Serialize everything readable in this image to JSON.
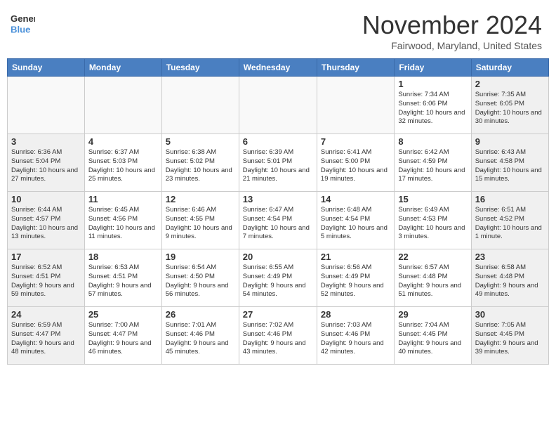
{
  "header": {
    "logo": {
      "general": "General",
      "blue": "Blue"
    },
    "title": "November 2024",
    "location": "Fairwood, Maryland, United States"
  },
  "calendar": {
    "days_of_week": [
      "Sunday",
      "Monday",
      "Tuesday",
      "Wednesday",
      "Thursday",
      "Friday",
      "Saturday"
    ],
    "weeks": [
      [
        {
          "day": "",
          "info": ""
        },
        {
          "day": "",
          "info": ""
        },
        {
          "day": "",
          "info": ""
        },
        {
          "day": "",
          "info": ""
        },
        {
          "day": "",
          "info": ""
        },
        {
          "day": "1",
          "info": "Sunrise: 7:34 AM\nSunset: 6:06 PM\nDaylight: 10 hours and 32 minutes."
        },
        {
          "day": "2",
          "info": "Sunrise: 7:35 AM\nSunset: 6:05 PM\nDaylight: 10 hours and 30 minutes."
        }
      ],
      [
        {
          "day": "3",
          "info": "Sunrise: 6:36 AM\nSunset: 5:04 PM\nDaylight: 10 hours and 27 minutes."
        },
        {
          "day": "4",
          "info": "Sunrise: 6:37 AM\nSunset: 5:03 PM\nDaylight: 10 hours and 25 minutes."
        },
        {
          "day": "5",
          "info": "Sunrise: 6:38 AM\nSunset: 5:02 PM\nDaylight: 10 hours and 23 minutes."
        },
        {
          "day": "6",
          "info": "Sunrise: 6:39 AM\nSunset: 5:01 PM\nDaylight: 10 hours and 21 minutes."
        },
        {
          "day": "7",
          "info": "Sunrise: 6:41 AM\nSunset: 5:00 PM\nDaylight: 10 hours and 19 minutes."
        },
        {
          "day": "8",
          "info": "Sunrise: 6:42 AM\nSunset: 4:59 PM\nDaylight: 10 hours and 17 minutes."
        },
        {
          "day": "9",
          "info": "Sunrise: 6:43 AM\nSunset: 4:58 PM\nDaylight: 10 hours and 15 minutes."
        }
      ],
      [
        {
          "day": "10",
          "info": "Sunrise: 6:44 AM\nSunset: 4:57 PM\nDaylight: 10 hours and 13 minutes."
        },
        {
          "day": "11",
          "info": "Sunrise: 6:45 AM\nSunset: 4:56 PM\nDaylight: 10 hours and 11 minutes."
        },
        {
          "day": "12",
          "info": "Sunrise: 6:46 AM\nSunset: 4:55 PM\nDaylight: 10 hours and 9 minutes."
        },
        {
          "day": "13",
          "info": "Sunrise: 6:47 AM\nSunset: 4:54 PM\nDaylight: 10 hours and 7 minutes."
        },
        {
          "day": "14",
          "info": "Sunrise: 6:48 AM\nSunset: 4:54 PM\nDaylight: 10 hours and 5 minutes."
        },
        {
          "day": "15",
          "info": "Sunrise: 6:49 AM\nSunset: 4:53 PM\nDaylight: 10 hours and 3 minutes."
        },
        {
          "day": "16",
          "info": "Sunrise: 6:51 AM\nSunset: 4:52 PM\nDaylight: 10 hours and 1 minute."
        }
      ],
      [
        {
          "day": "17",
          "info": "Sunrise: 6:52 AM\nSunset: 4:51 PM\nDaylight: 9 hours and 59 minutes."
        },
        {
          "day": "18",
          "info": "Sunrise: 6:53 AM\nSunset: 4:51 PM\nDaylight: 9 hours and 57 minutes."
        },
        {
          "day": "19",
          "info": "Sunrise: 6:54 AM\nSunset: 4:50 PM\nDaylight: 9 hours and 56 minutes."
        },
        {
          "day": "20",
          "info": "Sunrise: 6:55 AM\nSunset: 4:49 PM\nDaylight: 9 hours and 54 minutes."
        },
        {
          "day": "21",
          "info": "Sunrise: 6:56 AM\nSunset: 4:49 PM\nDaylight: 9 hours and 52 minutes."
        },
        {
          "day": "22",
          "info": "Sunrise: 6:57 AM\nSunset: 4:48 PM\nDaylight: 9 hours and 51 minutes."
        },
        {
          "day": "23",
          "info": "Sunrise: 6:58 AM\nSunset: 4:48 PM\nDaylight: 9 hours and 49 minutes."
        }
      ],
      [
        {
          "day": "24",
          "info": "Sunrise: 6:59 AM\nSunset: 4:47 PM\nDaylight: 9 hours and 48 minutes."
        },
        {
          "day": "25",
          "info": "Sunrise: 7:00 AM\nSunset: 4:47 PM\nDaylight: 9 hours and 46 minutes."
        },
        {
          "day": "26",
          "info": "Sunrise: 7:01 AM\nSunset: 4:46 PM\nDaylight: 9 hours and 45 minutes."
        },
        {
          "day": "27",
          "info": "Sunrise: 7:02 AM\nSunset: 4:46 PM\nDaylight: 9 hours and 43 minutes."
        },
        {
          "day": "28",
          "info": "Sunrise: 7:03 AM\nSunset: 4:46 PM\nDaylight: 9 hours and 42 minutes."
        },
        {
          "day": "29",
          "info": "Sunrise: 7:04 AM\nSunset: 4:45 PM\nDaylight: 9 hours and 40 minutes."
        },
        {
          "day": "30",
          "info": "Sunrise: 7:05 AM\nSunset: 4:45 PM\nDaylight: 9 hours and 39 minutes."
        }
      ]
    ]
  }
}
